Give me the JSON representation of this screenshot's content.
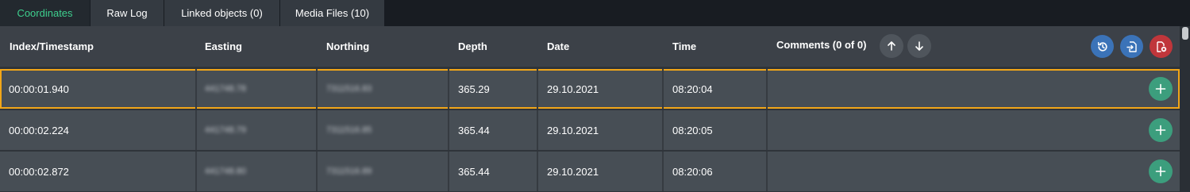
{
  "tabs": [
    {
      "label": "Coordinates",
      "active": true
    },
    {
      "label": "Raw Log"
    },
    {
      "label": "Linked objects (0)"
    },
    {
      "label": "Media Files (10)"
    }
  ],
  "header": {
    "index": "Index/Timestamp",
    "easting": "Easting",
    "northing": "Northing",
    "depth": "Depth",
    "date": "Date",
    "time": "Time",
    "comments": "Comments (0 of 0)"
  },
  "icons": {
    "sort_up": "arrow-up-icon",
    "sort_down": "arrow-down-icon",
    "history": "history-icon",
    "import": "import-file-icon",
    "delete": "delete-file-icon",
    "add": "plus-icon"
  },
  "colors": {
    "active_tab_text": "#3ecf8e",
    "selected_row_border": "#f2a618",
    "history_button": "#3b73b8",
    "import_button": "#3b73b8",
    "delete_button": "#c0363b",
    "add_button": "#3c9e7d"
  },
  "rows": [
    {
      "index": "00:00:01.940",
      "easting": "441748.78",
      "northing": "7311516.83",
      "depth": "365.29",
      "date": "29.10.2021",
      "time": "08:20:04",
      "selected": true
    },
    {
      "index": "00:00:02.224",
      "easting": "441748.79",
      "northing": "7311516.85",
      "depth": "365.44",
      "date": "29.10.2021",
      "time": "08:20:05"
    },
    {
      "index": "00:00:02.872",
      "easting": "441748.80",
      "northing": "7311516.89",
      "depth": "365.44",
      "date": "29.10.2021",
      "time": "08:20:06"
    }
  ]
}
